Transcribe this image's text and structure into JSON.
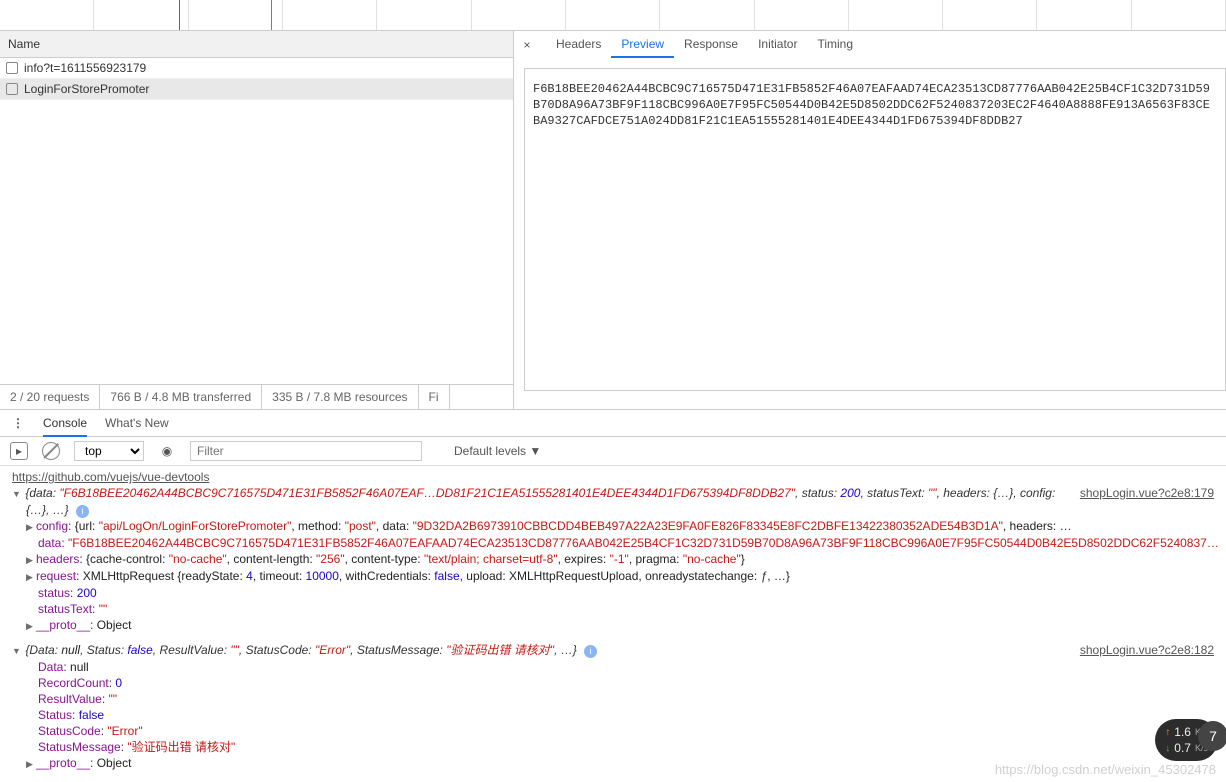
{
  "network": {
    "header": "Name",
    "requests": [
      {
        "name": "info?t=1611556923179",
        "selected": false
      },
      {
        "name": "LoginForStorePromoter",
        "selected": true
      }
    ],
    "status": {
      "count": "2 / 20 requests",
      "transferred": "766 B / 4.8 MB transferred",
      "resources": "335 B / 7.8 MB resources",
      "extra": "Fi"
    },
    "tabs": {
      "headers": "Headers",
      "preview": "Preview",
      "response": "Response",
      "initiator": "Initiator",
      "timing": "Timing"
    },
    "preview_text": "F6B18BEE20462A44BCBC9C716575D471E31FB5852F46A07EAFAAD74ECA23513CD87776AAB042E25B4CF1C32D731D59B70D8A96A73BF9F118CBC996A0E7F95FC50544D0B42E5D8502DDC62F5240837203EC2F4640A8888FE913A6563F83CEBA9327CAFDCE751A024DD81F21C1EA51555281401E4DEE4344D1FD675394DF8DDB27"
  },
  "drawer_tabs": {
    "console": "Console",
    "whatsnew": "What's New"
  },
  "toolbar": {
    "context": "top",
    "filter_placeholder": "Filter",
    "levels": "Default levels ▼"
  },
  "console": {
    "devtools_link": "https://github.com/vuejs/vue-devtools",
    "src1": "shopLogin.vue?c2e8:179",
    "src2": "shopLogin.vue?c2e8:182",
    "obj1": {
      "summary_data": "\"F6B18BEE20462A44BCBC9C716575D471E31FB5852F46A07EAF…DD81F21C1EA51555281401E4DEE4344D1FD675394DF8DDB27\"",
      "summary_status": "200",
      "summary_statusText": "\"\"",
      "summary_tail": "{…}, …}",
      "config_url": "\"api/LogOn/LoginForStorePromoter\"",
      "config_method": "\"post\"",
      "config_data": "\"9D32DA2B6973910CBBCDD4BEB497A22A23E9FA0FE826F83345E8FC2DBFE13422380352ADE54B3D1A\"",
      "data_full": "\"F6B18BEE20462A44BCBC9C716575D471E31FB5852F46A07EAFAAD74ECA23513CD87776AAB042E25B4CF1C32D731D59B70D8A96A73BF9F118CBC996A0E7F95FC50544D0B42E5D8502DDC62F5240837…",
      "hdr_cache": "\"no-cache\"",
      "hdr_len": "\"256\"",
      "hdr_ctype": "\"text/plain; charset=utf-8\"",
      "hdr_exp": "\"-1\"",
      "hdr_pragma": "\"no-cache\"",
      "req_ready": "4",
      "req_timeout": "10000",
      "req_cred": "false",
      "status": "200",
      "statusText": "\"\"",
      "proto": "Object"
    },
    "obj2": {
      "summary": "{Data: null, Status: false, ResultValue: \"\", StatusCode: \"Error\", StatusMessage: \"验证码出错 请核对\", …}",
      "Data": "null",
      "RecordCount": "0",
      "ResultValue": "\"\"",
      "Status": "false",
      "StatusCode": "\"Error\"",
      "StatusMessage": "\"验证码出错 请核对\"",
      "proto": "Object"
    }
  },
  "badge": {
    "up": "1.6",
    "dn": "0.7",
    "unit": "K/s",
    "circle": "7"
  },
  "watermark": "https://blog.csdn.net/weixin_45302478"
}
